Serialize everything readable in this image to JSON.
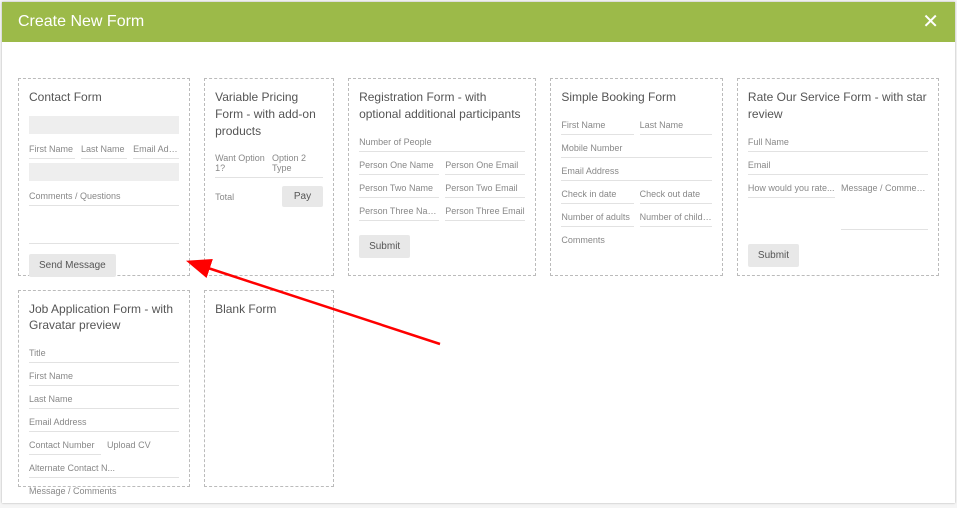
{
  "header": {
    "title": "Create New Form"
  },
  "cards": {
    "contact": {
      "title": "Contact Form",
      "fields": {
        "first": "First Name",
        "last": "Last Name",
        "email": "Email Addr...",
        "comments": "Comments / Questions"
      },
      "submit": "Send Message"
    },
    "pricing": {
      "title": "Variable Pricing Form - with add-on products",
      "opt1": "Want Option 1?",
      "opt2": "Option 2 Type",
      "total": "Total",
      "pay": "Pay"
    },
    "registration": {
      "title": "Registration Form - with optional additional participants",
      "numpeople": "Number of People",
      "p1n": "Person One Name",
      "p1e": "Person One Email",
      "p2n": "Person Two Name",
      "p2e": "Person Two Email",
      "p3n": "Person Three Name",
      "p3e": "Person Three Email",
      "submit": "Submit"
    },
    "booking": {
      "title": "Simple Booking Form",
      "first": "First Name",
      "last": "Last Name",
      "mobile": "Mobile Number",
      "email": "Email Address",
      "checkin": "Check in date",
      "checkout": "Check out date",
      "adults": "Number of adults",
      "children": "Number of children",
      "comments": "Comments"
    },
    "rate": {
      "title": "Rate Our Service Form - with star review",
      "name": "Full Name",
      "email": "Email",
      "rate": "How would you rate...",
      "msg": "Message / Comments",
      "submit": "Submit"
    },
    "job": {
      "title": "Job Application Form - with Gravatar preview",
      "jtitle": "Title",
      "first": "First Name",
      "last": "Last Name",
      "email": "Email Address",
      "contact": "Contact Number",
      "upload": "Upload CV",
      "alt": "Alternate Contact N...",
      "msg": "Message / Comments"
    },
    "blank": {
      "title": "Blank Form"
    }
  }
}
